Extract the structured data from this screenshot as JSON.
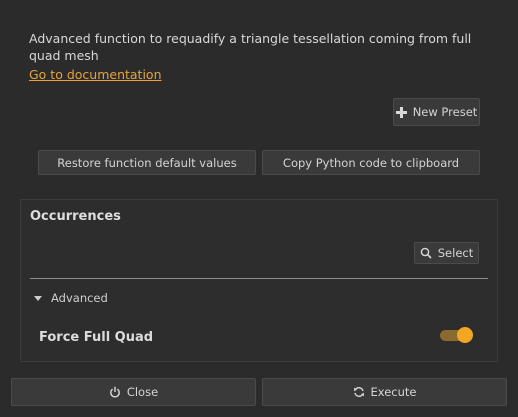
{
  "description": "Advanced function to requadify a triangle tessellation coming from full quad mesh",
  "doc_link": "Go to documentation",
  "buttons": {
    "new_preset": "New Preset",
    "restore_defaults": "Restore function default values",
    "copy_python": "Copy Python code to clipboard",
    "select": "Select",
    "close": "Close",
    "execute": "Execute"
  },
  "occurrences": {
    "title": "Occurrences"
  },
  "advanced": {
    "label": "Advanced",
    "expanded": true,
    "force_full_quad": {
      "label": "Force Full Quad",
      "enabled": true
    }
  },
  "colors": {
    "accent": "#f2a623",
    "link": "#e7a33a",
    "background": "#2b2b2b"
  },
  "icons": {
    "new_preset": "plus-icon",
    "select": "search-icon",
    "close": "power-icon",
    "execute": "refresh-icon",
    "advanced": "triangle-down-icon"
  }
}
